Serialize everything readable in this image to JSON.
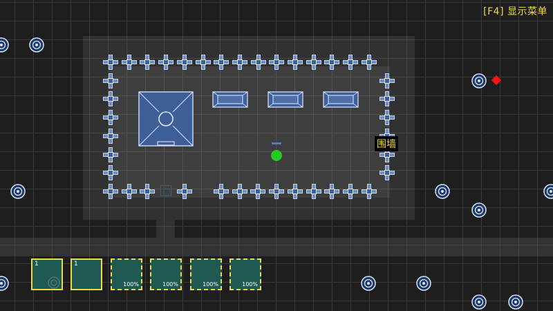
{
  "hud": {
    "menu_hint": "[F4] 显示菜单"
  },
  "tooltip": {
    "text": "围墙"
  },
  "icons": {
    "wall": "wall-segment-icon",
    "headquarters": "headquarters-icon",
    "barracks": "barracks-icon",
    "resource": "resource-node-icon",
    "enemy": "enemy-diamond-icon",
    "player": "player-unit-icon"
  },
  "colors": {
    "hint_text": "#f2d84a",
    "wall_fill": "#6d8dc4",
    "building_fill": "#3f5f99",
    "player": "#22cc22",
    "enemy": "#ff1111",
    "slot_fill": "#1f5a52",
    "slot_border": "#f2d84a"
  },
  "hotbar": [
    {
      "number": "1",
      "percent": "",
      "state": "ready"
    },
    {
      "number": "1",
      "percent": "",
      "state": "ready"
    },
    {
      "number": "",
      "percent": "100%",
      "state": "loading"
    },
    {
      "number": "",
      "percent": "100%",
      "state": "loading"
    },
    {
      "number": "",
      "percent": "100%",
      "state": "loading"
    },
    {
      "number": "",
      "percent": "100%",
      "state": "loading"
    }
  ]
}
